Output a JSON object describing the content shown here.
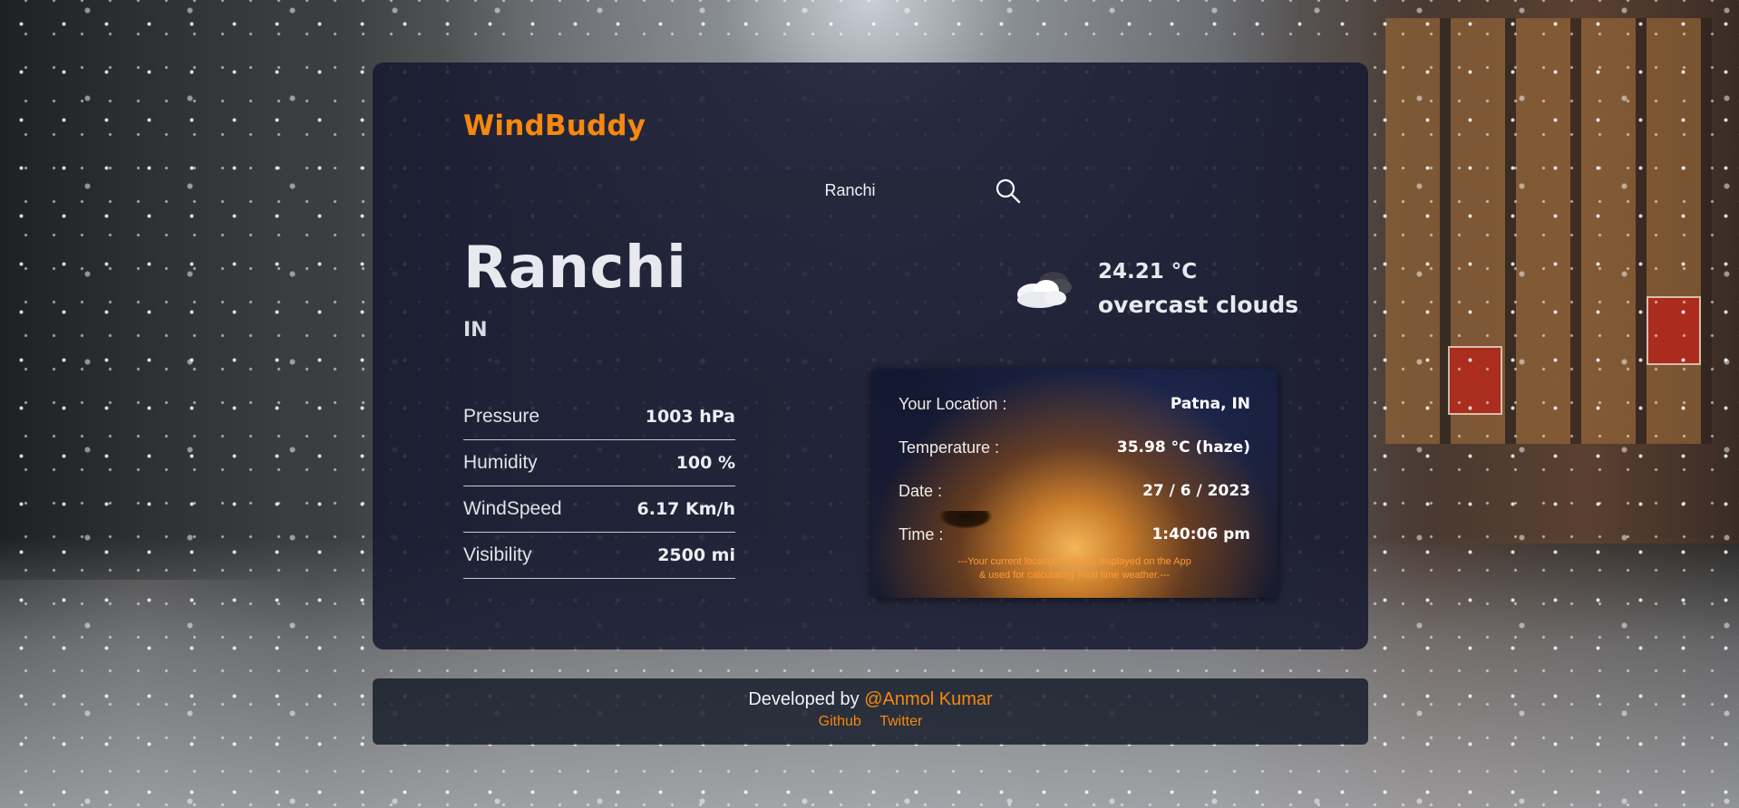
{
  "app": {
    "brand": "WindBuddy",
    "accent_color": "#f7870f"
  },
  "search": {
    "value": "Ranchi",
    "icon": "search-icon"
  },
  "weather": {
    "city": "Ranchi",
    "country": "IN",
    "temperature": "24.21 °C",
    "description": "overcast clouds",
    "icon": "cloud-icon",
    "stats": [
      {
        "label": "Pressure",
        "value": "1003 hPa"
      },
      {
        "label": "Humidity",
        "value": "100 %"
      },
      {
        "label": "WindSpeed",
        "value": "6.17 Km/h"
      },
      {
        "label": "Visibility",
        "value": "2500 mi"
      }
    ]
  },
  "current_location": {
    "rows": [
      {
        "label": "Your Location :",
        "value": "Patna, IN"
      },
      {
        "label": "Temperature :",
        "value": "35.98 °C (haze)"
      },
      {
        "label": "Date :",
        "value": "27 / 6 / 2023"
      },
      {
        "label": "Time :",
        "value": "1:40:06 pm"
      }
    ],
    "note_line1": "---Your current location is being displayed on the App",
    "note_line2": "& used for calculating Real time weather.---"
  },
  "footer": {
    "developed_by": "Developed by",
    "developer": "@Anmol Kumar",
    "links": [
      "Github",
      "Twitter"
    ]
  }
}
